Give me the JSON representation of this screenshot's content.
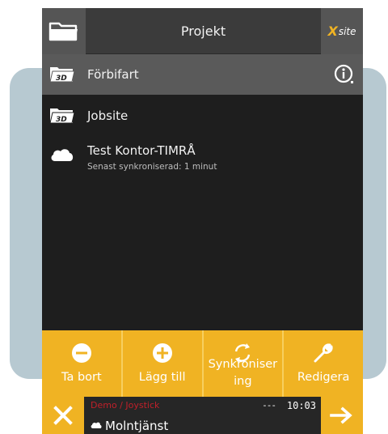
{
  "header": {
    "title": "Projekt",
    "logo_x": "X",
    "logo_text": "site",
    "folder_icon": "folder-icon"
  },
  "projects": [
    {
      "name": "Förbifart",
      "icon": "folder-3d-icon",
      "selected": true,
      "info_icon": "info-icon"
    },
    {
      "name": "Jobsite",
      "icon": "folder-3d-icon",
      "selected": false
    },
    {
      "name": "Test Kontor-TIMRÅ",
      "icon": "cloud-icon",
      "selected": false,
      "subtitle": "Senast synkroniserad: 1 minut"
    }
  ],
  "toolbar": {
    "delete_label": "Ta bort",
    "add_label": "Lägg till",
    "sync_label_1": "Synkroniser",
    "sync_label_2": "ing",
    "edit_label": "Redigera"
  },
  "status": {
    "mode": "Demo / Joystick",
    "signal": "---",
    "time": "10:03",
    "service": "Molntjänst"
  },
  "colors": {
    "accent": "#f0b323",
    "background": "#1e1e1e",
    "selected_row": "#5a5a5a",
    "mode_text": "#c0202a"
  }
}
